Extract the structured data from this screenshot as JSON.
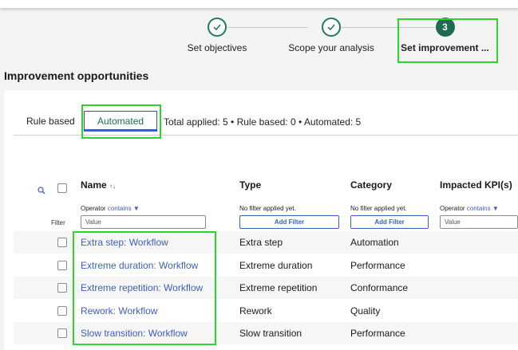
{
  "stepper": {
    "steps": [
      {
        "label": "Set objectives",
        "state": "done"
      },
      {
        "label": "Scope your analysis",
        "state": "done"
      },
      {
        "label": "Set improvement ...",
        "state": "current",
        "number": "3"
      }
    ]
  },
  "page": {
    "heading": "Improvement opportunities"
  },
  "tabs": {
    "items": [
      {
        "label": "Rule based"
      },
      {
        "label": "Automated"
      }
    ],
    "summary": "Total applied: 5 • Rule based: 0 • Automated: 5"
  },
  "table": {
    "columns": [
      {
        "label": "Name",
        "sort": "↑↓"
      },
      {
        "label": "Type"
      },
      {
        "label": "Category"
      },
      {
        "label": "Impacted KPI(s)"
      }
    ],
    "filter_label": "Filter",
    "filters": {
      "name": {
        "operator_label": "Operator",
        "operator_value": "contains",
        "placeholder": "Value"
      },
      "type": {
        "note": "No filter applied yet.",
        "button": "Add Filter"
      },
      "category": {
        "note": "No filter applied yet.",
        "button": "Add Filter"
      },
      "kpi": {
        "operator_label": "Operator",
        "operator_value": "contains",
        "placeholder": "Value"
      }
    },
    "rows": [
      {
        "name": "Extra step: Workflow",
        "type": "Extra step",
        "category": "Automation"
      },
      {
        "name": "Extreme duration: Workflow",
        "type": "Extreme duration",
        "category": "Performance"
      },
      {
        "name": "Extreme repetition: Workflow",
        "type": "Extreme repetition",
        "category": "Conformance"
      },
      {
        "name": "Rework: Workflow",
        "type": "Rework",
        "category": "Quality"
      },
      {
        "name": "Slow transition: Workflow",
        "type": "Slow transition",
        "category": "Performance"
      }
    ]
  },
  "colors": {
    "accent_green": "#1e6b52",
    "link_blue": "#3b5fc4",
    "highlight": "#2fd32f"
  },
  "icons": {
    "done": "check-icon",
    "filter_toggle": "filter-search-icon",
    "dropdown": "caret-down-icon"
  }
}
